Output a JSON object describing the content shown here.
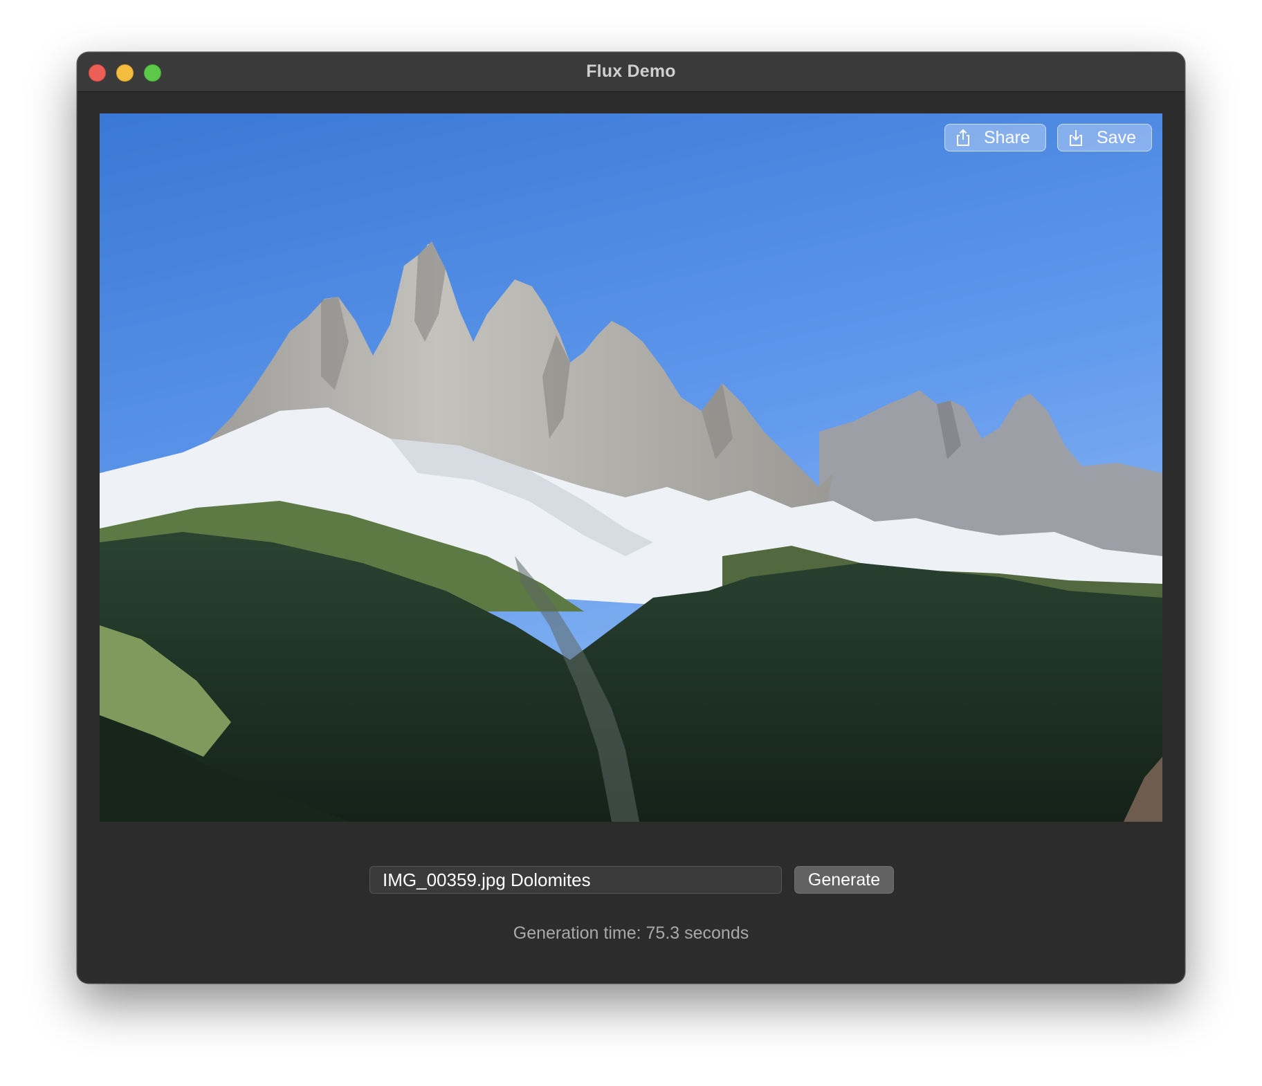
{
  "window": {
    "title": "Flux Demo"
  },
  "image": {
    "subject": "mountain-landscape",
    "colors": {
      "sky_top": "#3f7fdc",
      "sky_bottom": "#86b4f2",
      "rock": "#b3b1ad",
      "snow": "#eef1f5",
      "forest": "#1d3023"
    }
  },
  "overlay": {
    "share_label": "Share",
    "save_label": "Save",
    "share_icon": "share-icon",
    "save_icon": "save-icon"
  },
  "controls": {
    "prompt_value": "IMG_00359.jpg Dolomites",
    "generate_label": "Generate"
  },
  "status": {
    "text": "Generation time: 75.3 seconds"
  }
}
